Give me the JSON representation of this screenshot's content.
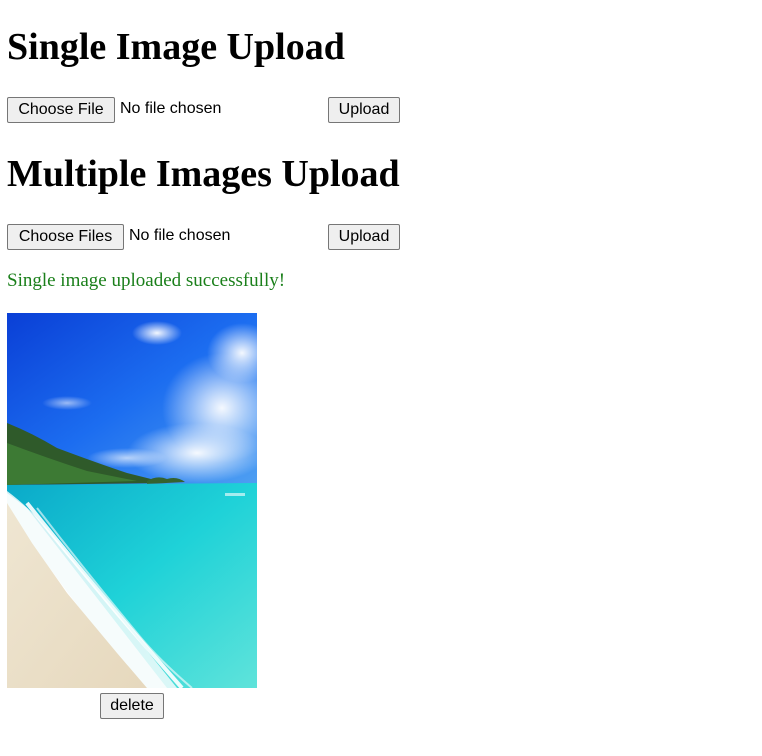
{
  "single": {
    "heading": "Single Image Upload",
    "choose_label": "Choose File",
    "status": "No file chosen",
    "upload_label": "Upload"
  },
  "multiple": {
    "heading": "Multiple Images Upload",
    "choose_label": "Choose Files",
    "status": "No file chosen",
    "upload_label": "Upload"
  },
  "message": {
    "text": "Single image uploaded successfully!",
    "color": "#1a7f1a"
  },
  "uploaded_image": {
    "delete_label": "delete"
  }
}
